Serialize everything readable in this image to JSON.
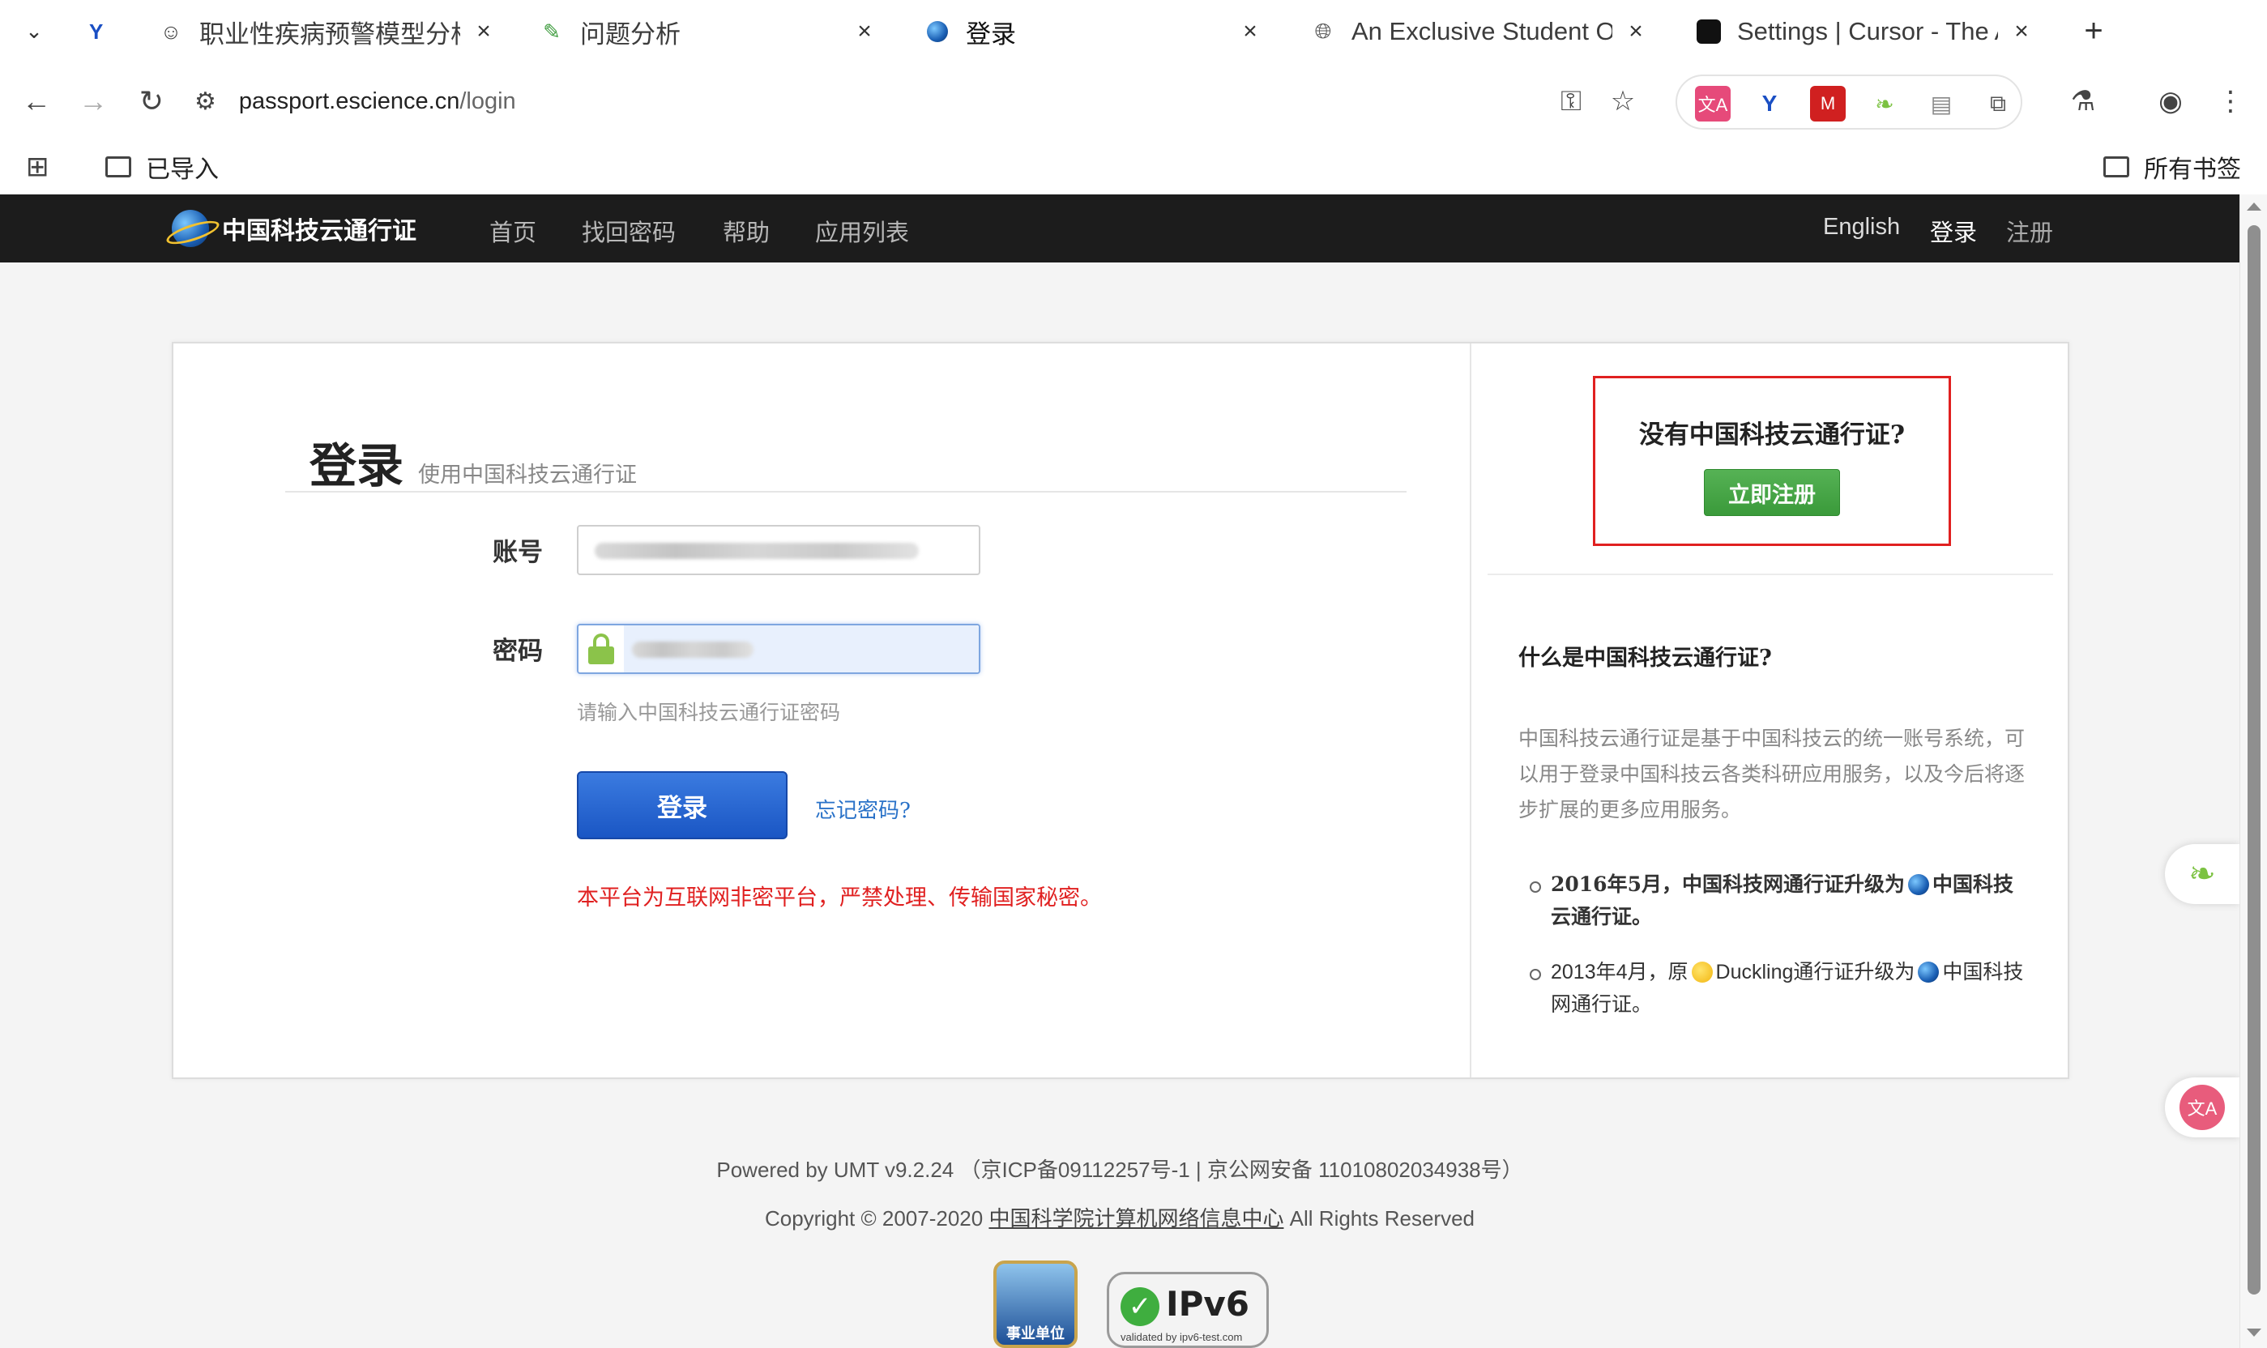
{
  "browser": {
    "tabs": [
      {
        "title": "职业性疾病预警模型分析",
        "icon": "assistant-logo-icon",
        "active": false
      },
      {
        "title": "问题分析",
        "icon": "edit-doc-icon",
        "active": false
      },
      {
        "title": "登录",
        "icon": "globe-icon",
        "active": true
      },
      {
        "title": "An Exclusive Student Off",
        "icon": "world-icon",
        "active": false
      },
      {
        "title": "Settings | Cursor - The AI",
        "icon": "cursor-logo-icon",
        "active": false
      }
    ],
    "url_host": "passport.escience.cn",
    "url_path": "/login",
    "bookmarks": {
      "imported": "已导入",
      "all": "所有书签"
    }
  },
  "site_nav": {
    "logo": "中国科技云通行证",
    "links": [
      "首页",
      "找回密码",
      "帮助",
      "应用列表"
    ],
    "right": {
      "lang": "English",
      "login": "登录",
      "register": "注册"
    }
  },
  "login": {
    "title": "登录",
    "subtitle": "使用中国科技云通行证",
    "account_label": "账号",
    "password_label": "密码",
    "password_hint": "请输入中国科技云通行证密码",
    "submit": "登录",
    "forgot": "忘记密码?",
    "warning": "本平台为互联网非密平台，严禁处理、传输国家秘密。"
  },
  "sidebar": {
    "question": "没有中国科技云通行证?",
    "register_btn": "立即注册",
    "what_title": "什么是中国科技云通行证?",
    "what_desc": "中国科技云通行证是基于中国科技云的统一账号系统，可以用于登录中国科技云各类科研应用服务，以及今后将逐步扩展的更多应用服务。",
    "history": [
      {
        "pre": "2016年5月，中国科技网通行证升级为",
        "post": "中国科技云通行证。"
      },
      {
        "pre": "2013年4月，原",
        "mid": "Duckling通行证升级为",
        "post": "中国科技网通行证。"
      }
    ]
  },
  "footer": {
    "powered": "Powered by UMT v9.2.24 （京ICP备09112257号-1 | 京公网安备 11010802034938号）",
    "copyright_pre": "Copyright © 2007-2020 ",
    "copyright_link": "中国科学院计算机网络信息中心",
    "copyright_post": " All Rights Reserved",
    "badge_unit": "事业单位",
    "badge_ipv6": "IPv6",
    "badge_ipv6_sub": "validated by ipv6-test.com"
  },
  "colors": {
    "nav_bg": "#1c1c1c",
    "primary": "#1a56c4",
    "register": "#3a9a3a",
    "warning": "#e02020",
    "link": "#2a72c8"
  }
}
